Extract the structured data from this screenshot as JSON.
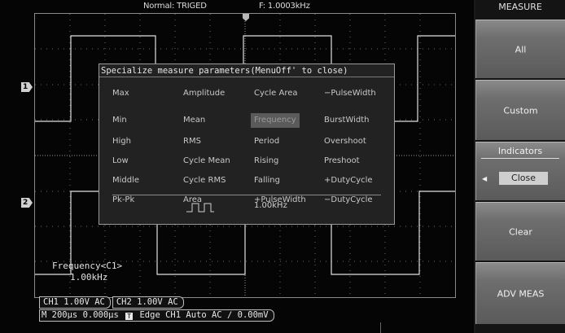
{
  "status": {
    "mode": "Normal: TRIGED",
    "frequency": "F: 1.0003kHz"
  },
  "channels": {
    "ch1_marker": "1",
    "ch2_marker": "2",
    "ch1_setting": "CH1  1.00V  AC",
    "ch2_setting": "CH2  1.00V  AC"
  },
  "timebase": {
    "time": "M 200μs 0.000μs",
    "trigger_icon": "T",
    "trigger": "Edge  CH1  Auto  AC",
    "trigger_slope": "∕",
    "trigger_level": "0.00mV"
  },
  "readout": {
    "label": "Frequency<C1>",
    "value": "1.00kHz"
  },
  "dialog": {
    "title": "Specialize measure parameters(MenuOff' to close)",
    "columns": [
      [
        "Max",
        "Min",
        "High",
        "Low",
        "Middle",
        "Pk-Pk"
      ],
      [
        "Amplitude",
        "Mean",
        "RMS",
        "Cycle Mean",
        "Cycle RMS",
        "Area"
      ],
      [
        "Cycle Area",
        "Frequency",
        "Period",
        "Rising",
        "Falling",
        "+PulseWidth"
      ],
      [
        "−PulseWidth",
        "BurstWidth",
        "Overshoot",
        "Preshoot",
        "+DutyCycle",
        "−DutyCycle"
      ]
    ],
    "selected": "Frequency",
    "preview_value": "1.00kHz"
  },
  "menu": {
    "title": "MEASURE",
    "all": "All",
    "custom": "Custom",
    "indicators_label": "Indicators",
    "indicators_value": "Close",
    "clear": "Clear",
    "adv": "ADV MEAS"
  },
  "colors": {
    "trace": "#e0e0e0",
    "selected_bg": "#5a5a5a"
  },
  "icons": {
    "pulse": "square-pulse-icon",
    "trigger_marker": "trigger-position-icon"
  }
}
